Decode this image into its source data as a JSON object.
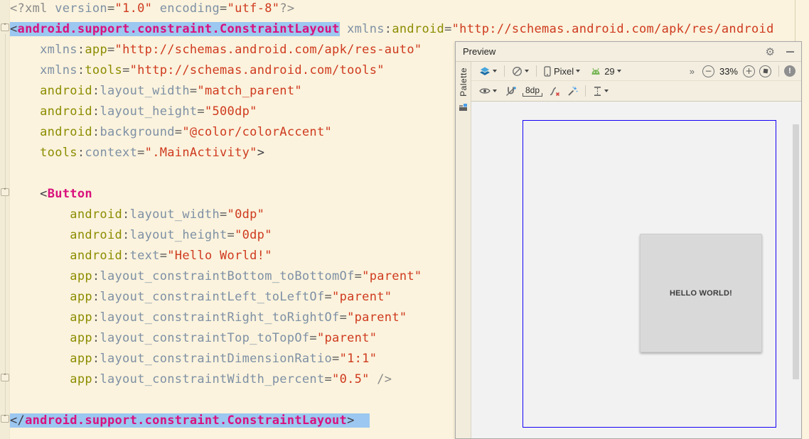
{
  "editor": {
    "colors": {
      "background": "#FBF3DD",
      "selection": "#9CC7F0",
      "tag": "#D9117D",
      "namespace_prefix": "#8C8C00",
      "attribute_name": "#7E90A5",
      "string": "#CF3A1F"
    },
    "fold_markers": [
      {
        "line": 2,
        "type": "fold-start"
      },
      {
        "line": 10,
        "type": "fold-start"
      },
      {
        "line": 19,
        "type": "fold-end"
      },
      {
        "line": 21,
        "type": "fold-end"
      }
    ],
    "lines": [
      {
        "tokens": [
          [
            "g",
            "<?xml "
          ],
          [
            "an",
            "version"
          ],
          [
            "eq",
            "="
          ],
          [
            "str",
            "\"1.0\""
          ],
          [
            "g",
            " "
          ],
          [
            "an",
            "encoding"
          ],
          [
            "eq",
            "="
          ],
          [
            "str",
            "\"utf-8\""
          ],
          [
            "g",
            "?>"
          ]
        ]
      },
      {
        "tokens": [
          [
            "p",
            "<",
            1
          ],
          [
            "tag",
            "android.support.constraint.ConstraintLayout",
            1
          ],
          [
            "g",
            " "
          ],
          [
            "an",
            "xmlns"
          ],
          [
            "eq",
            ":"
          ],
          [
            "ns",
            "android"
          ],
          [
            "eq",
            "="
          ],
          [
            "str",
            "\"http://schemas.android.com/apk/res/android"
          ]
        ]
      },
      {
        "tokens": [
          [
            "g",
            "    "
          ],
          [
            "an",
            "xmlns"
          ],
          [
            "eq",
            ":"
          ],
          [
            "ns",
            "app"
          ],
          [
            "eq",
            "="
          ],
          [
            "str",
            "\"http://schemas.android.com/apk/res-auto\""
          ]
        ]
      },
      {
        "tokens": [
          [
            "g",
            "    "
          ],
          [
            "an",
            "xmlns"
          ],
          [
            "eq",
            ":"
          ],
          [
            "ns",
            "tools"
          ],
          [
            "eq",
            "="
          ],
          [
            "str",
            "\"http://schemas.android.com/tools\""
          ]
        ]
      },
      {
        "tokens": [
          [
            "g",
            "    "
          ],
          [
            "ns",
            "android"
          ],
          [
            "eq",
            ":"
          ],
          [
            "an",
            "layout_width"
          ],
          [
            "eq",
            "="
          ],
          [
            "str",
            "\"match_parent\""
          ]
        ]
      },
      {
        "tokens": [
          [
            "g",
            "    "
          ],
          [
            "ns",
            "android"
          ],
          [
            "eq",
            ":"
          ],
          [
            "an",
            "layout_height"
          ],
          [
            "eq",
            "="
          ],
          [
            "str",
            "\"500dp\""
          ]
        ]
      },
      {
        "tokens": [
          [
            "g",
            "    "
          ],
          [
            "ns",
            "android"
          ],
          [
            "eq",
            ":"
          ],
          [
            "an",
            "background"
          ],
          [
            "eq",
            "="
          ],
          [
            "str",
            "\"@color/colorAccent\""
          ]
        ]
      },
      {
        "tokens": [
          [
            "g",
            "    "
          ],
          [
            "ns",
            "tools"
          ],
          [
            "eq",
            ":"
          ],
          [
            "an",
            "context"
          ],
          [
            "eq",
            "="
          ],
          [
            "str",
            "\".MainActivity\""
          ],
          [
            "p",
            ">"
          ]
        ]
      },
      {
        "tokens": []
      },
      {
        "tokens": [
          [
            "g",
            "    "
          ],
          [
            "p",
            "<"
          ],
          [
            "tag",
            "Button"
          ]
        ]
      },
      {
        "tokens": [
          [
            "g",
            "        "
          ],
          [
            "ns",
            "android"
          ],
          [
            "eq",
            ":"
          ],
          [
            "an",
            "layout_width"
          ],
          [
            "eq",
            "="
          ],
          [
            "str",
            "\"0dp\""
          ]
        ]
      },
      {
        "tokens": [
          [
            "g",
            "        "
          ],
          [
            "ns",
            "android"
          ],
          [
            "eq",
            ":"
          ],
          [
            "an",
            "layout_height"
          ],
          [
            "eq",
            "="
          ],
          [
            "str",
            "\"0dp\""
          ]
        ]
      },
      {
        "tokens": [
          [
            "g",
            "        "
          ],
          [
            "ns",
            "android"
          ],
          [
            "eq",
            ":"
          ],
          [
            "an",
            "text"
          ],
          [
            "eq",
            "="
          ],
          [
            "str",
            "\"Hello World!\""
          ]
        ]
      },
      {
        "tokens": [
          [
            "g",
            "        "
          ],
          [
            "ns",
            "app"
          ],
          [
            "eq",
            ":"
          ],
          [
            "an",
            "layout_constraintBottom_toBottomOf"
          ],
          [
            "eq",
            "="
          ],
          [
            "str",
            "\"parent\""
          ]
        ]
      },
      {
        "tokens": [
          [
            "g",
            "        "
          ],
          [
            "ns",
            "app"
          ],
          [
            "eq",
            ":"
          ],
          [
            "an",
            "layout_constraintLeft_toLeftOf"
          ],
          [
            "eq",
            "="
          ],
          [
            "str",
            "\"parent\""
          ]
        ]
      },
      {
        "tokens": [
          [
            "g",
            "        "
          ],
          [
            "ns",
            "app"
          ],
          [
            "eq",
            ":"
          ],
          [
            "an",
            "layout_constraintRight_toRightOf"
          ],
          [
            "eq",
            "="
          ],
          [
            "str",
            "\"parent\""
          ]
        ]
      },
      {
        "tokens": [
          [
            "g",
            "        "
          ],
          [
            "ns",
            "app"
          ],
          [
            "eq",
            ":"
          ],
          [
            "an",
            "layout_constraintTop_toTopOf"
          ],
          [
            "eq",
            "="
          ],
          [
            "str",
            "\"parent\""
          ]
        ]
      },
      {
        "tokens": [
          [
            "g",
            "        "
          ],
          [
            "ns",
            "app"
          ],
          [
            "eq",
            ":"
          ],
          [
            "an",
            "layout_constraintDimensionRatio"
          ],
          [
            "eq",
            "="
          ],
          [
            "str",
            "\"1:1\""
          ]
        ]
      },
      {
        "tokens": [
          [
            "g",
            "        "
          ],
          [
            "ns",
            "app"
          ],
          [
            "eq",
            ":"
          ],
          [
            "an",
            "layout_constraintWidth_percent"
          ],
          [
            "eq",
            "="
          ],
          [
            "str",
            "\"0.5\""
          ],
          [
            "g",
            " />"
          ]
        ]
      },
      {
        "tokens": []
      },
      {
        "tokens": [
          [
            "p",
            "</",
            1
          ],
          [
            "tag",
            "android.support.constraint.ConstraintLayout",
            1
          ],
          [
            "p",
            ">",
            1
          ],
          [
            "g",
            "  ",
            1
          ]
        ]
      }
    ]
  },
  "preview": {
    "title": "Preview",
    "window_icons": [
      "gear-icon",
      "minimize-icon"
    ],
    "palette_tab": "Palette",
    "toolbar_top": {
      "icons": [
        "design-surface-layers-icon",
        "orientation-icon",
        "phone-device-icon",
        "android-head-icon",
        "overflow-chevrons-icon",
        "zoom-out-icon",
        "zoom-in-icon",
        "zoom-to-fit-icon",
        "warning-icon"
      ],
      "device": "Pixel",
      "api_level": "29",
      "overflow": "»",
      "zoom_out": "−",
      "zoom_level": "33%",
      "zoom_in": "+",
      "warning": "!"
    },
    "toolbar_design": {
      "icons": [
        "view-options-eye-icon",
        "autoconnect-off-magnet-icon",
        "clear-constraints-icon",
        "infer-constraints-wand-icon",
        "distribute-vertical-icon"
      ],
      "default_margin": "8dp"
    },
    "canvas": {
      "layout_color": "#D4195E",
      "layout_border_color": "#1400F5",
      "button_label": "HELLO WORLD!",
      "button_color": "#D9D9D9"
    }
  }
}
